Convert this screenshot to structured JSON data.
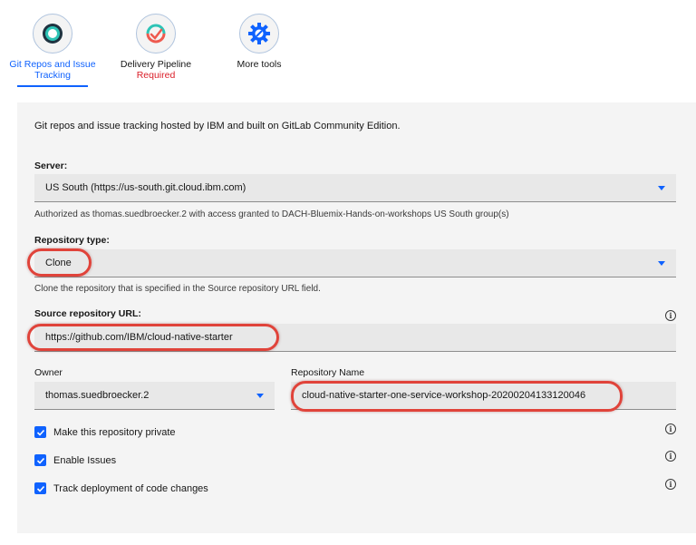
{
  "toolbar": {
    "tiles": [
      {
        "label": "Git Repos and Issue Tracking",
        "active": true
      },
      {
        "label": "Delivery Pipeline",
        "sublabel": "Required"
      },
      {
        "label": "More tools"
      }
    ]
  },
  "description": "Git repos and issue tracking hosted by IBM and built on GitLab Community Edition.",
  "server": {
    "label": "Server:",
    "value": "US South (https://us-south.git.cloud.ibm.com)",
    "helper": "Authorized as thomas.suedbroecker.2 with access granted to DACH-Bluemix-Hands-on-workshops US South group(s)"
  },
  "repository_type": {
    "label": "Repository type:",
    "value": "Clone",
    "helper": "Clone the repository that is specified in the Source repository URL field."
  },
  "source_url": {
    "label": "Source repository URL:",
    "value": "https://github.com/IBM/cloud-native-starter"
  },
  "owner": {
    "label": "Owner",
    "value": "thomas.suedbroecker.2"
  },
  "repository_name": {
    "label": "Repository Name",
    "value": "cloud-native-starter-one-service-workshop-20200204133120046"
  },
  "options": [
    {
      "label": "Make this repository private",
      "checked": true
    },
    {
      "label": "Enable Issues",
      "checked": true
    },
    {
      "label": "Track deployment of code changes",
      "checked": true
    }
  ],
  "colors": {
    "accent": "#0f62fe",
    "required": "#da1e28",
    "annotation": "#e0433a"
  }
}
